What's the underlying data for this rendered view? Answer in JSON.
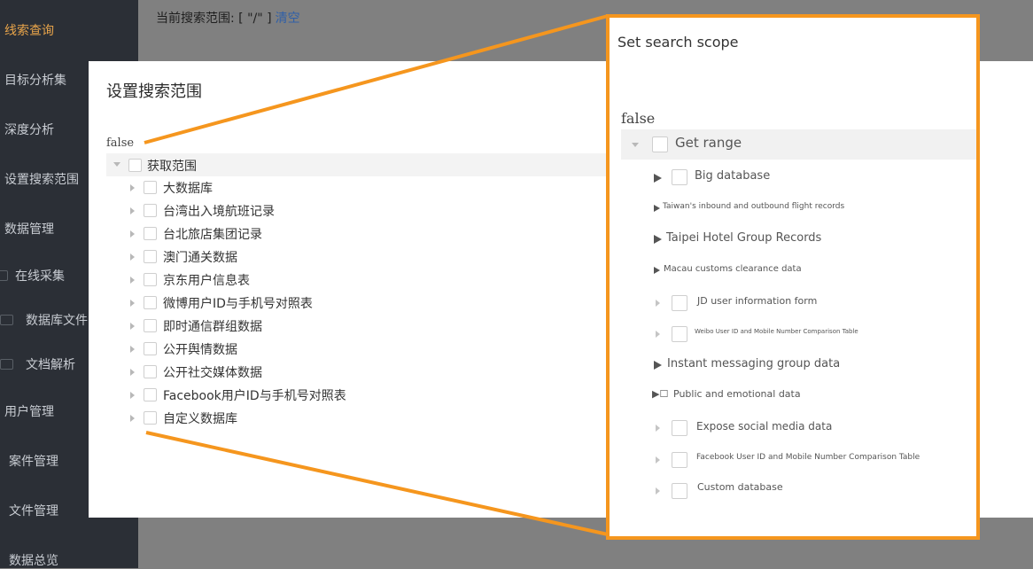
{
  "sidebar": {
    "items": [
      {
        "label": "线索查询",
        "active": true
      },
      {
        "label": "目标分析集"
      },
      {
        "label": "深度分析"
      },
      {
        "label": "设置搜索范围"
      },
      {
        "label": "数据管理"
      },
      {
        "label": "在线采集",
        "icon": "grid-icon"
      },
      {
        "label": "数据库文件",
        "icon": "folder-icon"
      },
      {
        "label": "文档解析",
        "icon": "folder-icon"
      },
      {
        "label": "用户管理"
      },
      {
        "label": "案件管理"
      },
      {
        "label": "文件管理"
      },
      {
        "label": "数据总览"
      }
    ]
  },
  "scope_bar": {
    "label": "当前搜索范围: [ \"/\" ]",
    "clear": "清空"
  },
  "dialog": {
    "title": "设置搜索范围",
    "false_text": "false",
    "root": "获取范围",
    "items": [
      "大数据库",
      "台湾出入境航班记录",
      "台北旅店集团记录",
      "澳门通关数据",
      "京东用户信息表",
      "微博用户ID与手机号对照表",
      "即时通信群组数据",
      "公开舆情数据",
      "公开社交媒体数据",
      "Facebook用户ID与手机号对照表",
      "自定义数据库"
    ]
  },
  "callout": {
    "title": "Set search scope",
    "false_text": "false",
    "root": "Get range",
    "items": [
      "Big database",
      "Taiwan's inbound and outbound flight records",
      "Taipei Hotel Group Records",
      "Macau customs clearance data",
      "JD user information form",
      "Weibo User ID and Mobile Number Comparison Table",
      "Instant messaging group data",
      "Public and emotional data",
      "Expose social media data",
      "Facebook User ID and Mobile Number Comparison Table",
      "Custom database"
    ],
    "public_prefix": "▶☐"
  },
  "colors": {
    "sidebar_bg": "#2b2f36",
    "active": "#e8a44a",
    "callout_border": "#f5961e",
    "link": "#2f5fa8"
  }
}
